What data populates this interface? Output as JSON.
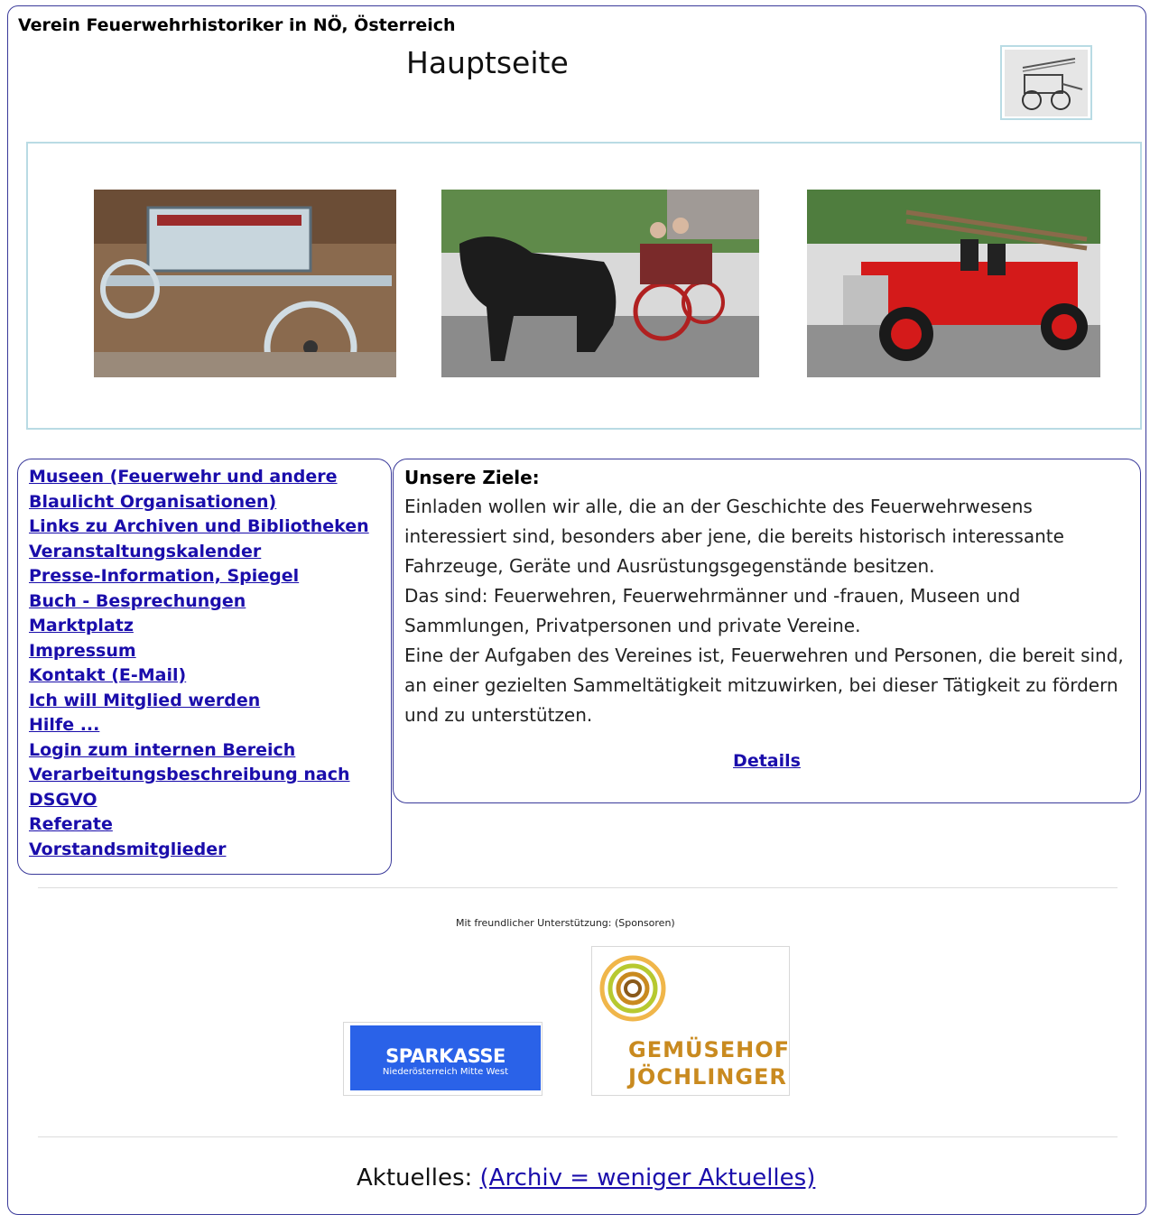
{
  "header": {
    "site_title": "Verein Feuerwehrhistoriker in NÖ, Österreich",
    "page_title": "Hauptseite"
  },
  "nav": {
    "items": [
      "Museen (Feuerwehr und andere",
      "Blaulicht Organisationen)",
      "Links zu Archiven und Bibliotheken",
      "Veranstaltungskalender",
      "Presse-Information, Spiegel",
      "Buch - Besprechungen",
      "Marktplatz",
      "Impressum",
      "Kontakt (E-Mail)",
      "Ich will Mitglied werden",
      "Hilfe ...",
      "Login zum internen Bereich",
      "Verarbeitungsbeschreibung nach",
      "DSGVO",
      "Referate",
      "Vorstandsmitglieder"
    ]
  },
  "content": {
    "heading": "Unsere Ziele:",
    "paragraphs": [
      "Einladen wollen wir alle, die an der Geschichte des Feuerwehrwesens interessiert sind, besonders aber jene, die bereits historisch interessante Fahrzeuge, Geräte und Ausrüstungsgegenstände besitzen.",
      "Das sind: Feuerwehren, Feuerwehrmänner und -frauen, Museen und Sammlungen, Privatpersonen und private Vereine.",
      "Eine der Aufgaben des Vereines ist, Feuerwehren und Personen, die bereit sind, an einer gezielten Sammeltätigkeit mitzuwirken, bei dieser Tätigkeit zu fördern und zu unterstützen."
    ],
    "details_link": "Details"
  },
  "sponsors": {
    "caption": "Mit freundlicher Unterstützung: (Sponsoren)",
    "sparkasse_name": "SPARKASSE",
    "sparkasse_sub": "Niederösterreich Mitte West",
    "gemuese_line1": "GEMÜSEHOF",
    "gemuese_line2": "JÖCHLINGER"
  },
  "news": {
    "label": "Aktuelles:",
    "archive_link": "(Archiv = weniger Aktuelles)"
  },
  "colors": {
    "link": "#1a0dab",
    "border": "#3a3a9a",
    "gallery_border": "#b9dbe4",
    "sparkasse_blue": "#2a62e8",
    "gemuese_gold": "#c98a1f"
  }
}
